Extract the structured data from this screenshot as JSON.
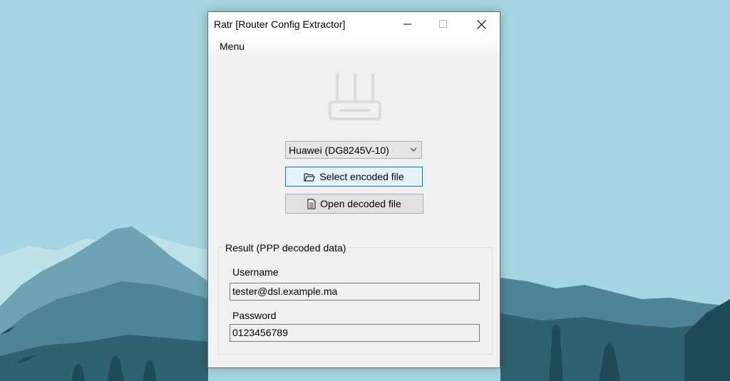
{
  "window": {
    "title": "Ratr [Router Config Extractor]"
  },
  "menubar": {
    "menu_label": "Menu"
  },
  "router_selector": {
    "selected": "Huawei (DG8245V-10)"
  },
  "buttons": {
    "select_encoded": "Select encoded file",
    "open_decoded": "Open decoded file"
  },
  "result": {
    "title": "Result (PPP decoded data)",
    "username_label": "Username",
    "username_value": "tester@dsl.example.ma",
    "password_label": "Password",
    "password_value": "0123456789"
  },
  "colors": {
    "sky": "#a6d6e3",
    "accent_border": "#0078d7",
    "accent_bg": "#e5f1fb"
  },
  "icons": {
    "router": "router-icon",
    "folder": "folder-open-icon",
    "document": "document-icon",
    "dropdown": "chevron-down-icon"
  }
}
